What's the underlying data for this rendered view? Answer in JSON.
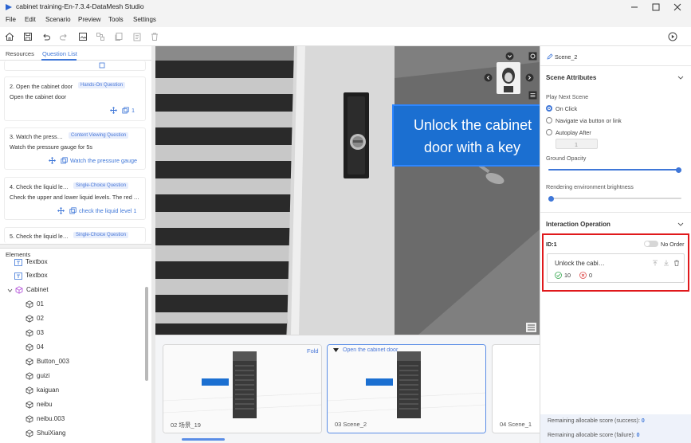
{
  "window": {
    "title": "cabinet training-En-7.3.4-DataMesh Studio"
  },
  "menu": [
    "File",
    "Edit",
    "Scenario",
    "Preview",
    "Tools",
    "Settings"
  ],
  "left_tabs": [
    "Resources",
    "Question List"
  ],
  "questions": [
    {
      "title": "2. Open the cabinet door",
      "badge": "Hands-On Question",
      "desc": "Open the cabinet door",
      "link": "1"
    },
    {
      "title": "3. Watch the press…",
      "badge": "Content Viewing Question",
      "desc": "Watch the pressure gauge for 5s",
      "link": "Watch the pressure gauge"
    },
    {
      "title": "4. Check the liquid le…",
      "badge": "Single-Choice Question",
      "desc": "Check the upper and lower liquid levels. The red …",
      "link": "check the liquid level 1"
    },
    {
      "title": "5. Check the liquid le…",
      "badge": "Single-Choice Question"
    }
  ],
  "elements": {
    "header": "Elements",
    "items": [
      "Textbox",
      "Textbox",
      "Cabinet",
      "01",
      "02",
      "03",
      "04",
      "Button_003",
      "guizi",
      "kaiguan",
      "neibu",
      "neibu.003",
      "ShuiXiang"
    ]
  },
  "viewport": {
    "label_line1": "Unlock the cabinet",
    "label_line2": "door with a key"
  },
  "filmstrip": {
    "fold": "Fold",
    "thumbs": [
      {
        "label": "02 场景_19"
      },
      {
        "label": "03 Scene_2",
        "title": "Open the cabinet door"
      },
      {
        "label": "04 Scene_1"
      }
    ]
  },
  "right_panel": {
    "scene_name": "Scene_2",
    "scene_attributes": "Scene Attributes",
    "play_next_scene": "Play Next Scene",
    "options": [
      "On Click",
      "Navigate via button or link",
      "Autoplay After"
    ],
    "autoplay_value": "1",
    "ground_opacity": "Ground Opacity",
    "ground_opacity_level": 1.0,
    "render_brightness": "Rendering environment brightness",
    "render_brightness_level": 0.0,
    "interaction_operation": "Interaction Operation",
    "interaction": {
      "id": "ID:1",
      "order_label": "No Order",
      "item_title": "Unlock the cabi…",
      "success_score": "10",
      "failure_score": "0"
    },
    "footer_success_label": "Remaining allocable score (success):",
    "footer_success_value": "0",
    "footer_failure_label": "Remaining allocable score (failure):",
    "footer_failure_value": "0"
  },
  "colors": {
    "accent": "#3f77d8",
    "highlight_box": "#e0191c",
    "viewport_label_bg": "#1b6fd1"
  }
}
